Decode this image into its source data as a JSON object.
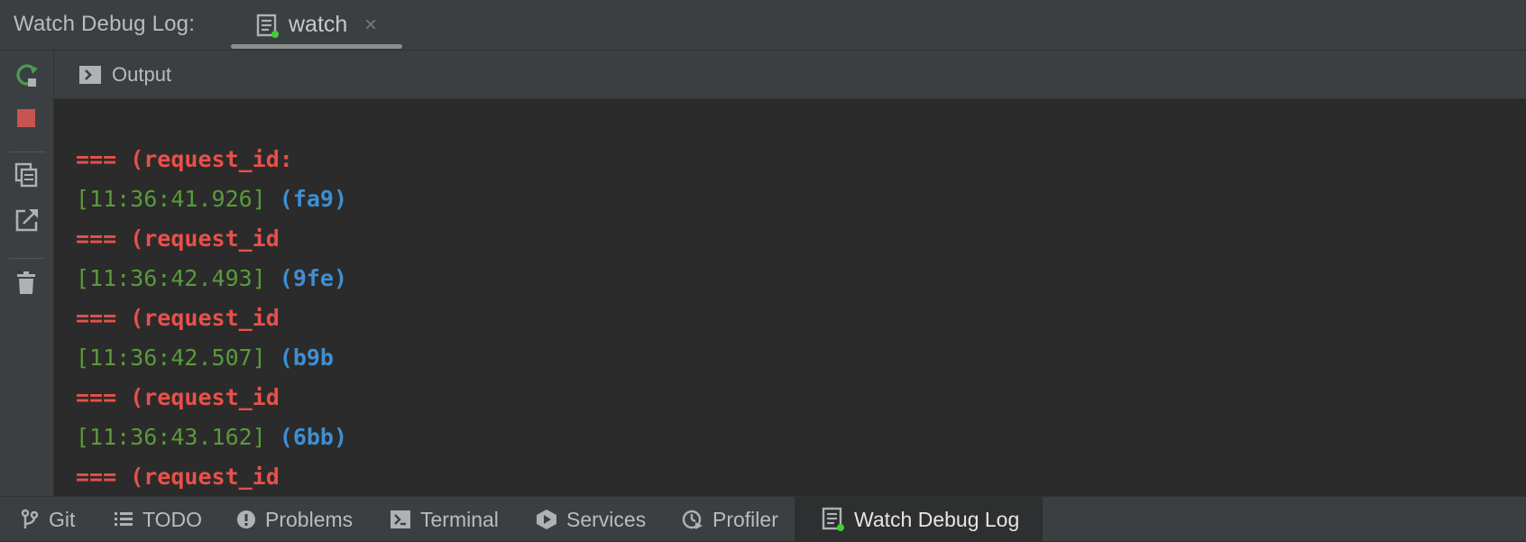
{
  "header": {
    "title": "Watch Debug Log:",
    "tab": {
      "label": "watch",
      "close": "×",
      "icon": "doc-icon",
      "status": "running"
    }
  },
  "toolbar": {
    "buttons": [
      "rerun-icon",
      "stop-icon",
      "copy-icon",
      "open-external-icon",
      "trash-icon"
    ]
  },
  "output": {
    "title": "Output",
    "icon": "terminal-icon"
  },
  "console": {
    "lines": [
      {
        "kind": "request",
        "text": "=== (request_id:"
      },
      {
        "kind": "log",
        "timestamp": "[11:36:41.926]",
        "id": "(fa9)"
      },
      {
        "kind": "request",
        "text": "=== (request_id"
      },
      {
        "kind": "log",
        "timestamp": "[11:36:42.493]",
        "id": "(9fe)"
      },
      {
        "kind": "request",
        "text": "=== (request_id"
      },
      {
        "kind": "log",
        "timestamp": "[11:36:42.507]",
        "id": "(b9b"
      },
      {
        "kind": "request",
        "text": "=== (request_id"
      },
      {
        "kind": "log",
        "timestamp": "[11:36:43.162]",
        "id": "(6bb)"
      },
      {
        "kind": "request",
        "text": "=== (request_id"
      }
    ]
  },
  "bottom_bar": {
    "items": [
      {
        "label": "Git",
        "icon": "git-branch-icon"
      },
      {
        "label": "TODO",
        "icon": "list-icon"
      },
      {
        "label": "Problems",
        "icon": "exclamation-icon"
      },
      {
        "label": "Terminal",
        "icon": "terminal-icon"
      },
      {
        "label": "Services",
        "icon": "services-play-icon"
      },
      {
        "label": "Profiler",
        "icon": "profiler-icon"
      },
      {
        "label": "Watch Debug Log",
        "icon": "doc-icon",
        "active": true
      }
    ]
  },
  "colors": {
    "background": "#2b2b2b",
    "panel": "#3c3f41",
    "request_text": "#e8504a",
    "timestamp": "#5b9a3b",
    "request_id": "#3f8fd2",
    "run_green": "#499c54",
    "stop_red": "#c75450"
  }
}
